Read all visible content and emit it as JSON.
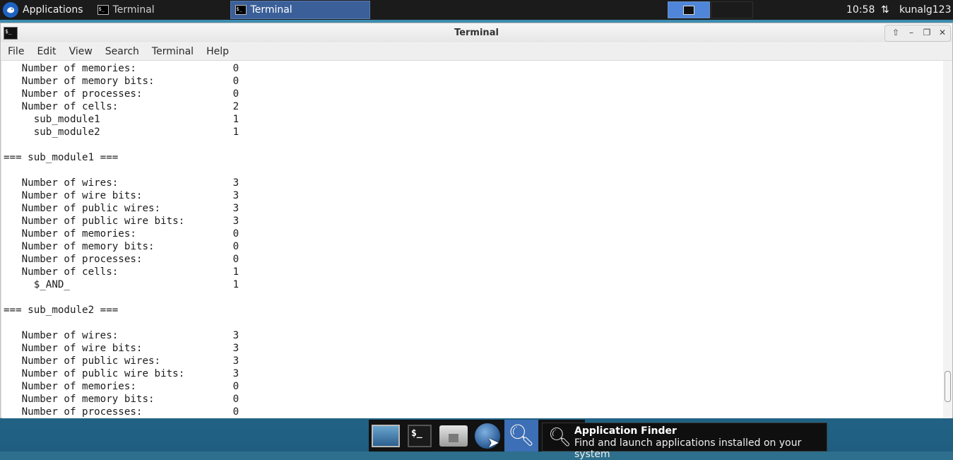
{
  "top_panel": {
    "applications_label": "Applications",
    "tasks": [
      {
        "label": "Terminal",
        "active": false
      },
      {
        "label": "Terminal",
        "active": true
      }
    ],
    "clock": "10:58",
    "user": "kunalg123",
    "icons": [
      "xfce-logo-icon",
      "terminal-icon",
      "network-icon"
    ]
  },
  "window": {
    "title": "Terminal",
    "menu": [
      "File",
      "Edit",
      "View",
      "Search",
      "Terminal",
      "Help"
    ],
    "controls": [
      "shade-up-icon",
      "minimize-icon",
      "maximize-icon",
      "close-icon"
    ]
  },
  "terminal": {
    "lines": [
      "   Number of memories:                0",
      "   Number of memory bits:             0",
      "   Number of processes:               0",
      "   Number of cells:                   2",
      "     sub_module1                      1",
      "     sub_module2                      1",
      "",
      "=== sub_module1 ===",
      "",
      "   Number of wires:                   3",
      "   Number of wire bits:               3",
      "   Number of public wires:            3",
      "   Number of public wire bits:        3",
      "   Number of memories:                0",
      "   Number of memory bits:             0",
      "   Number of processes:               0",
      "   Number of cells:                   1",
      "     $_AND_                           1",
      "",
      "=== sub_module2 ===",
      "",
      "   Number of wires:                   3",
      "   Number of wire bits:               3",
      "   Number of public wires:            3",
      "   Number of public wire bits:        3",
      "   Number of memories:                0",
      "   Number of memory bits:             0",
      "   Number of processes:               0"
    ]
  },
  "dock": {
    "items": [
      "show-desktop-icon",
      "terminal-icon",
      "file-manager-icon",
      "web-browser-icon",
      "app-finder-icon"
    ]
  },
  "tooltip": {
    "title": "Application Finder",
    "subtitle": "Find and launch applications installed on your system"
  }
}
